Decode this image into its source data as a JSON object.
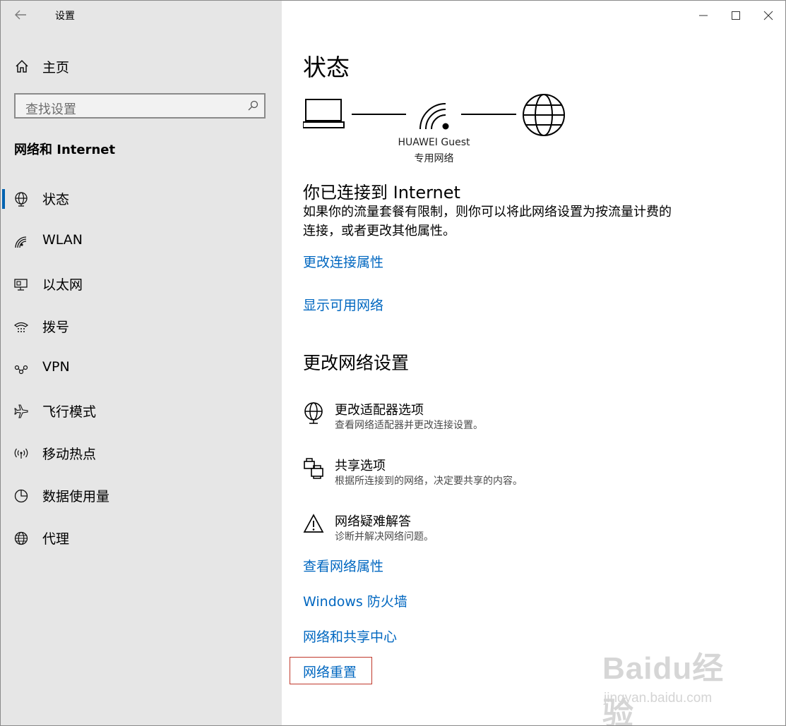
{
  "app": {
    "title": "设置"
  },
  "sidebar": {
    "home_label": "主页",
    "search_placeholder": "查找设置",
    "section_title": "网络和 Internet",
    "items": [
      {
        "label": "状态",
        "icon": "globe-network-icon",
        "active": true
      },
      {
        "label": "WLAN",
        "icon": "wifi-icon"
      },
      {
        "label": "以太网",
        "icon": "ethernet-icon"
      },
      {
        "label": "拨号",
        "icon": "dialup-icon"
      },
      {
        "label": "VPN",
        "icon": "vpn-icon"
      },
      {
        "label": "飞行模式",
        "icon": "airplane-icon"
      },
      {
        "label": "移动热点",
        "icon": "hotspot-icon"
      },
      {
        "label": "数据使用量",
        "icon": "data-usage-icon"
      },
      {
        "label": "代理",
        "icon": "globe-icon"
      }
    ]
  },
  "main": {
    "title": "状态",
    "network_name": "HUAWEI Guest",
    "network_type": "专用网络",
    "connection_title": "你已连接到 Internet",
    "connection_desc": "如果你的流量套餐有限制，则你可以将此网络设置为按流量计费的连接，或者更改其他属性。",
    "link_change_props": "更改连接属性",
    "link_show_networks": "显示可用网络",
    "change_settings_title": "更改网络设置",
    "options": [
      {
        "title": "更改适配器选项",
        "desc": "查看网络适配器并更改连接设置。",
        "icon": "adapter-icon"
      },
      {
        "title": "共享选项",
        "desc": "根据所连接到的网络，决定要共享的内容。",
        "icon": "sharing-icon"
      },
      {
        "title": "网络疑难解答",
        "desc": "诊断并解决网络问题。",
        "icon": "warning-icon"
      }
    ],
    "links": [
      "查看网络属性",
      "Windows 防火墙",
      "网络和共享中心",
      "网络重置"
    ]
  },
  "watermark": {
    "logo": "Baidu经验",
    "site": "jingyan.baidu.com"
  },
  "colors": {
    "accent": "#0063b1",
    "link": "#0067c0",
    "sidebar_bg": "#e6e6e6",
    "highlight_border": "#c0392b"
  }
}
